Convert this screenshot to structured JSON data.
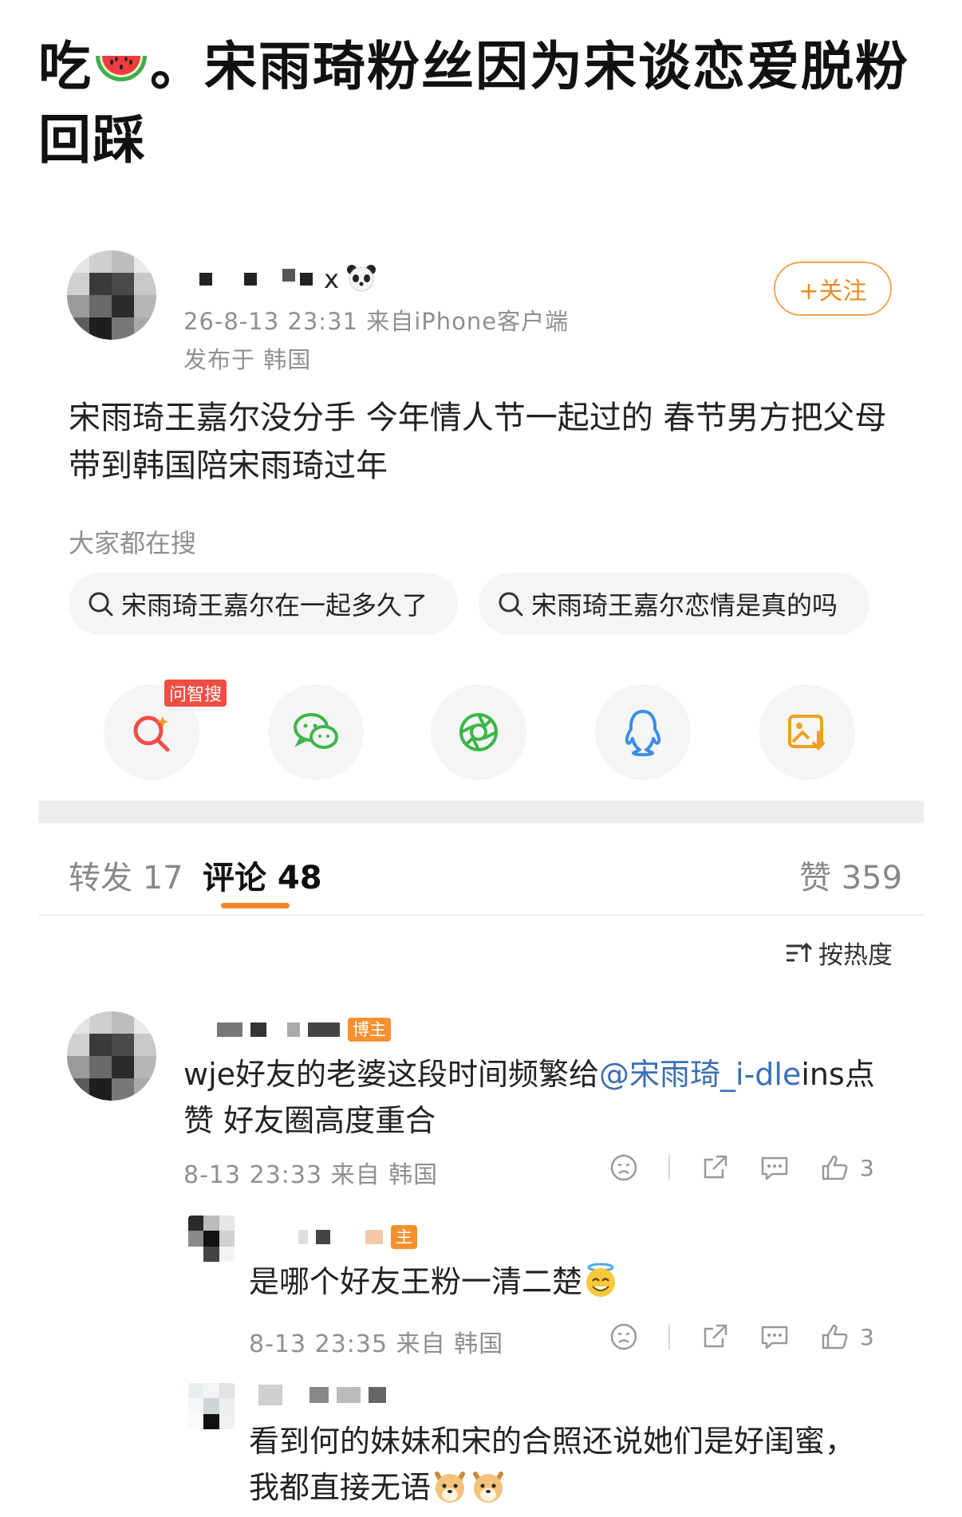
{
  "headline": {
    "prefix": "吃",
    "melon_icon": "watermelon-icon",
    "text": "。宋雨琦粉丝因为宋谈恋爱脱粉回踩"
  },
  "post": {
    "username_suffix": "x",
    "username_icon": "panda-icon",
    "time_source": "26-8-13 23:31  来自iPhone客户端",
    "location": "发布于 韩国",
    "follow_label": "+关注",
    "text": "宋雨琦王嘉尔没分手 今年情人节一起过的 春节男方把父母带到韩国陪宋雨琦过年",
    "search_heading": "大家都在搜",
    "search_suggestions": [
      "宋雨琦王嘉尔在一起多久了",
      "宋雨琦王嘉尔恋情是真的吗"
    ],
    "share_items": [
      {
        "name": "ai-search-icon",
        "tag": "问智搜"
      },
      {
        "name": "wechat-icon"
      },
      {
        "name": "moments-icon"
      },
      {
        "name": "qq-icon"
      },
      {
        "name": "save-image-icon"
      }
    ]
  },
  "tabs": {
    "repost": "转发 17",
    "comments": "评论 48",
    "likes": "赞 359"
  },
  "sort_label": "按热度",
  "colors": {
    "accent": "#f5862a",
    "mention": "#3a6fb5",
    "tag_red": "#f04e45"
  },
  "comments": [
    {
      "badge": "博主",
      "text_before": "wje好友的老婆这段时间频繁给",
      "mention": "@宋雨琦_i-dle",
      "text_after": "ins点赞 好友圈高度重合",
      "meta": "8-13 23:33 来自 韩国",
      "likes": "3"
    },
    {
      "badge": "主",
      "text": "是哪个好友王粉一清二楚",
      "emoji": "innocent-smile-icon",
      "meta": "8-13 23:35 来自 韩国",
      "likes": "3"
    },
    {
      "text_line1": "看到何的妹妹和宋的合照还说她们是好闺蜜，",
      "text_line2": "我都直接无语",
      "emoji": "doge-icon"
    }
  ]
}
